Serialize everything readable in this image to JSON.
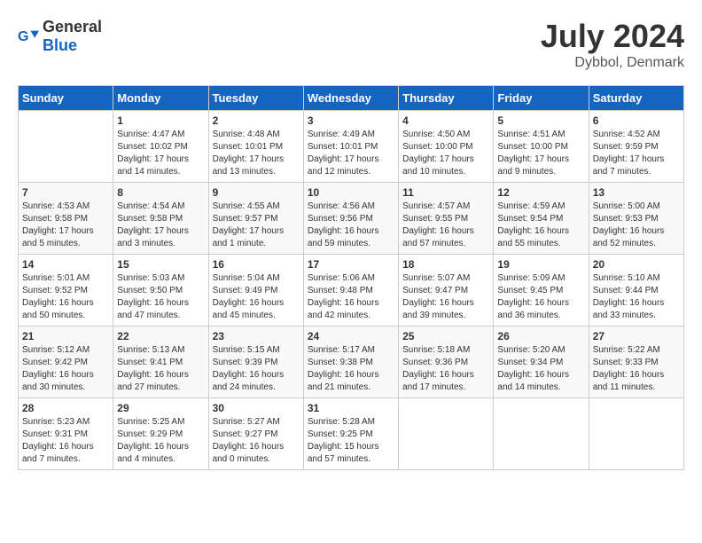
{
  "header": {
    "logo_general": "General",
    "logo_blue": "Blue",
    "month_year": "July 2024",
    "location": "Dybbol, Denmark"
  },
  "days_of_week": [
    "Sunday",
    "Monday",
    "Tuesday",
    "Wednesday",
    "Thursday",
    "Friday",
    "Saturday"
  ],
  "weeks": [
    [
      {
        "day": "",
        "info": ""
      },
      {
        "day": "1",
        "info": "Sunrise: 4:47 AM\nSunset: 10:02 PM\nDaylight: 17 hours\nand 14 minutes."
      },
      {
        "day": "2",
        "info": "Sunrise: 4:48 AM\nSunset: 10:01 PM\nDaylight: 17 hours\nand 13 minutes."
      },
      {
        "day": "3",
        "info": "Sunrise: 4:49 AM\nSunset: 10:01 PM\nDaylight: 17 hours\nand 12 minutes."
      },
      {
        "day": "4",
        "info": "Sunrise: 4:50 AM\nSunset: 10:00 PM\nDaylight: 17 hours\nand 10 minutes."
      },
      {
        "day": "5",
        "info": "Sunrise: 4:51 AM\nSunset: 10:00 PM\nDaylight: 17 hours\nand 9 minutes."
      },
      {
        "day": "6",
        "info": "Sunrise: 4:52 AM\nSunset: 9:59 PM\nDaylight: 17 hours\nand 7 minutes."
      }
    ],
    [
      {
        "day": "7",
        "info": "Sunrise: 4:53 AM\nSunset: 9:58 PM\nDaylight: 17 hours\nand 5 minutes."
      },
      {
        "day": "8",
        "info": "Sunrise: 4:54 AM\nSunset: 9:58 PM\nDaylight: 17 hours\nand 3 minutes."
      },
      {
        "day": "9",
        "info": "Sunrise: 4:55 AM\nSunset: 9:57 PM\nDaylight: 17 hours\nand 1 minute."
      },
      {
        "day": "10",
        "info": "Sunrise: 4:56 AM\nSunset: 9:56 PM\nDaylight: 16 hours\nand 59 minutes."
      },
      {
        "day": "11",
        "info": "Sunrise: 4:57 AM\nSunset: 9:55 PM\nDaylight: 16 hours\nand 57 minutes."
      },
      {
        "day": "12",
        "info": "Sunrise: 4:59 AM\nSunset: 9:54 PM\nDaylight: 16 hours\nand 55 minutes."
      },
      {
        "day": "13",
        "info": "Sunrise: 5:00 AM\nSunset: 9:53 PM\nDaylight: 16 hours\nand 52 minutes."
      }
    ],
    [
      {
        "day": "14",
        "info": "Sunrise: 5:01 AM\nSunset: 9:52 PM\nDaylight: 16 hours\nand 50 minutes."
      },
      {
        "day": "15",
        "info": "Sunrise: 5:03 AM\nSunset: 9:50 PM\nDaylight: 16 hours\nand 47 minutes."
      },
      {
        "day": "16",
        "info": "Sunrise: 5:04 AM\nSunset: 9:49 PM\nDaylight: 16 hours\nand 45 minutes."
      },
      {
        "day": "17",
        "info": "Sunrise: 5:06 AM\nSunset: 9:48 PM\nDaylight: 16 hours\nand 42 minutes."
      },
      {
        "day": "18",
        "info": "Sunrise: 5:07 AM\nSunset: 9:47 PM\nDaylight: 16 hours\nand 39 minutes."
      },
      {
        "day": "19",
        "info": "Sunrise: 5:09 AM\nSunset: 9:45 PM\nDaylight: 16 hours\nand 36 minutes."
      },
      {
        "day": "20",
        "info": "Sunrise: 5:10 AM\nSunset: 9:44 PM\nDaylight: 16 hours\nand 33 minutes."
      }
    ],
    [
      {
        "day": "21",
        "info": "Sunrise: 5:12 AM\nSunset: 9:42 PM\nDaylight: 16 hours\nand 30 minutes."
      },
      {
        "day": "22",
        "info": "Sunrise: 5:13 AM\nSunset: 9:41 PM\nDaylight: 16 hours\nand 27 minutes."
      },
      {
        "day": "23",
        "info": "Sunrise: 5:15 AM\nSunset: 9:39 PM\nDaylight: 16 hours\nand 24 minutes."
      },
      {
        "day": "24",
        "info": "Sunrise: 5:17 AM\nSunset: 9:38 PM\nDaylight: 16 hours\nand 21 minutes."
      },
      {
        "day": "25",
        "info": "Sunrise: 5:18 AM\nSunset: 9:36 PM\nDaylight: 16 hours\nand 17 minutes."
      },
      {
        "day": "26",
        "info": "Sunrise: 5:20 AM\nSunset: 9:34 PM\nDaylight: 16 hours\nand 14 minutes."
      },
      {
        "day": "27",
        "info": "Sunrise: 5:22 AM\nSunset: 9:33 PM\nDaylight: 16 hours\nand 11 minutes."
      }
    ],
    [
      {
        "day": "28",
        "info": "Sunrise: 5:23 AM\nSunset: 9:31 PM\nDaylight: 16 hours\nand 7 minutes."
      },
      {
        "day": "29",
        "info": "Sunrise: 5:25 AM\nSunset: 9:29 PM\nDaylight: 16 hours\nand 4 minutes."
      },
      {
        "day": "30",
        "info": "Sunrise: 5:27 AM\nSunset: 9:27 PM\nDaylight: 16 hours\nand 0 minutes."
      },
      {
        "day": "31",
        "info": "Sunrise: 5:28 AM\nSunset: 9:25 PM\nDaylight: 15 hours\nand 57 minutes."
      },
      {
        "day": "",
        "info": ""
      },
      {
        "day": "",
        "info": ""
      },
      {
        "day": "",
        "info": ""
      }
    ]
  ]
}
